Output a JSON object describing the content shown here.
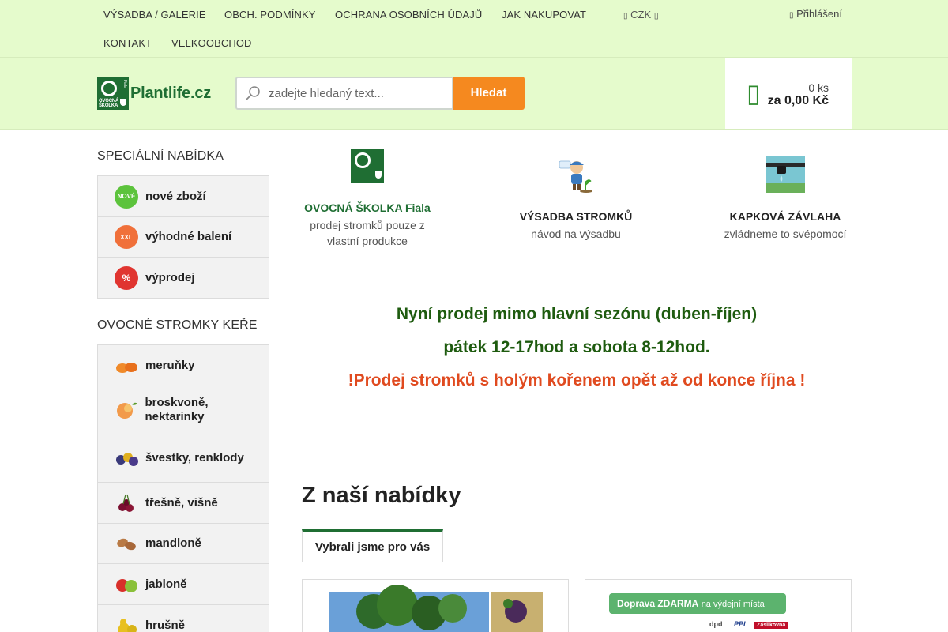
{
  "topnav": {
    "links": [
      "VÝSADBA / GALERIE",
      "OBCH. PODMÍNKY",
      "OCHRANA OSOBNÍCH ÚDAJŮ",
      "JAK NAKUPOVAT",
      "KONTAKT",
      "VELKOOBCHOD"
    ],
    "currency": "CZK",
    "login": "Přihlášení"
  },
  "header": {
    "logo_text": "Plantlife.cz",
    "logo_badge": [
      "OVOCNÁ",
      "ŠKOLKA"
    ],
    "logo_vertical": "Fiala",
    "search_placeholder": "zadejte hledaný text...",
    "search_button": "Hledat",
    "cart_qty": "0 ks",
    "cart_price": "za 0,00 Kč"
  },
  "sidebar": {
    "special_title": "SPECIÁLNÍ NABÍDKA",
    "special_items": [
      {
        "label": "nové zboží",
        "badge": "NOVÉ",
        "color": "#5cc33c"
      },
      {
        "label": "výhodné balení",
        "badge": "XXL",
        "color": "#f0703a"
      },
      {
        "label": "výprodej",
        "badge": "%",
        "color": "#e03530"
      }
    ],
    "fruit_title": "OVOCNÉ STROMKY KEŘE",
    "fruit_items": [
      {
        "label": "meruňky",
        "icon": "apricot-icon"
      },
      {
        "label": "broskvoně, nektarinky",
        "icon": "peach-icon"
      },
      {
        "label": "švestky, renklody",
        "icon": "plum-icon"
      },
      {
        "label": "třešně, višně",
        "icon": "cherry-icon"
      },
      {
        "label": "mandloně",
        "icon": "almond-icon"
      },
      {
        "label": "jabloně",
        "icon": "apple-icon"
      },
      {
        "label": "hrušně",
        "icon": "pear-icon"
      }
    ]
  },
  "features": [
    {
      "title": "OVOCNÁ ŠKOLKA Fiala",
      "sub": "prodej stromků pouze z vlastní produkce",
      "title_color": "#1f6e33"
    },
    {
      "title": "VÝSADBA STROMKŮ",
      "sub": "návod na výsadbu",
      "title_color": "#222222"
    },
    {
      "title": "KAPKOVÁ ZÁVLAHA",
      "sub": "zvládneme to svépomocí",
      "title_color": "#222222"
    }
  ],
  "announcement": {
    "line1": "Nyní prodej mimo hlavní sezónu (duben-říjen)",
    "line2": "pátek 12-17hod a sobota 8-12hod.",
    "line3": "!Prodej stromků s holým kořenem opět až od konce října !"
  },
  "offers": {
    "title": "Z naší nabídky",
    "tab": "Vybrali jsme pro vás",
    "banner_text": "Doprava ZDARMA",
    "banner_suffix": "na výdejní místa",
    "carriers": [
      "dpd",
      "PPL",
      "Zásilkovna"
    ]
  },
  "colors": {
    "nav_bg": "#e5fbcc",
    "brand_green": "#1f6e33",
    "accent_orange": "#f5891f",
    "announcement_green": "#1e5b0f",
    "announcement_red": "#e04a1f"
  }
}
